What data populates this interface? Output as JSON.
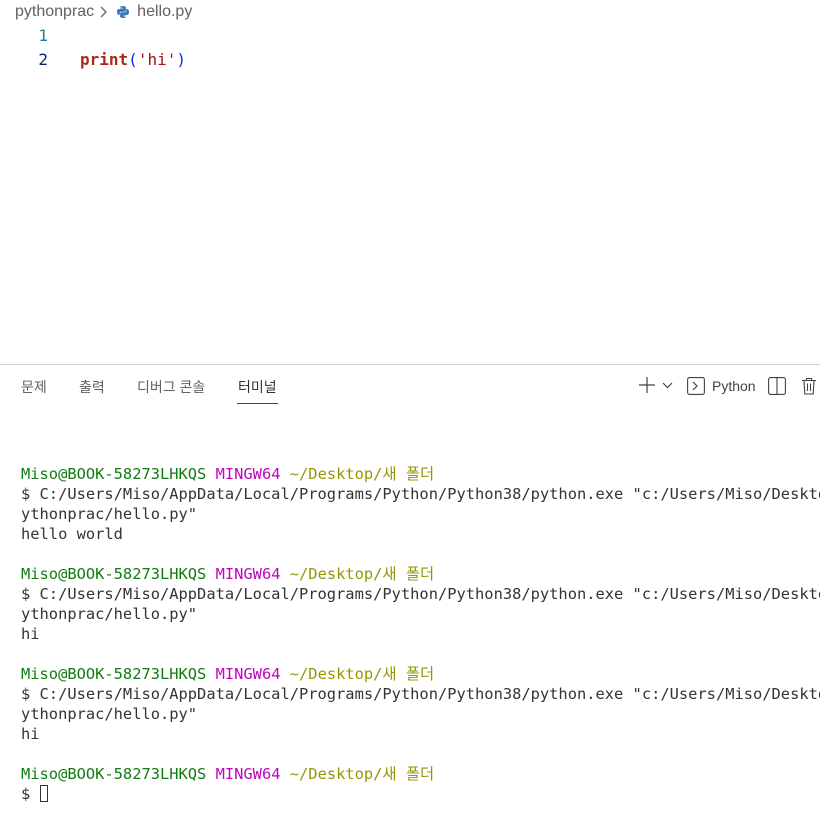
{
  "breadcrumb": {
    "folder": "pythonprac",
    "file": "hello.py"
  },
  "editor": {
    "lines": [
      {
        "number": "1",
        "tokens": []
      },
      {
        "number": "2",
        "fn": "print",
        "open": "(",
        "str": "'hi'",
        "close": ")"
      }
    ]
  },
  "panel": {
    "tabs": [
      "문제",
      "출력",
      "디버그 콘솔",
      "터미널"
    ],
    "active_tab": "터미널",
    "terminal_profile": "Python"
  },
  "terminal": {
    "blocks": [
      {
        "user": "Miso@BOOK-58273LHKQS",
        "env": "MINGW64",
        "path": "~/Desktop/새 폴더",
        "cmd1": "$ C:/Users/Miso/AppData/Local/Programs/Python/Python38/python.exe \"c:/Users/Miso/Desktop/",
        "cmd2": "ythonprac/hello.py\"",
        "output": "hello world"
      },
      {
        "user": "Miso@BOOK-58273LHKQS",
        "env": "MINGW64",
        "path": "~/Desktop/새 폴더",
        "cmd1": "$ C:/Users/Miso/AppData/Local/Programs/Python/Python38/python.exe \"c:/Users/Miso/Desktop/",
        "cmd2": "ythonprac/hello.py\"",
        "output": "hi"
      },
      {
        "user": "Miso@BOOK-58273LHKQS",
        "env": "MINGW64",
        "path": "~/Desktop/새 폴더",
        "cmd1": "$ C:/Users/Miso/AppData/Local/Programs/Python/Python38/python.exe \"c:/Users/Miso/Desktop/",
        "cmd2": "ythonprac/hello.py\"",
        "output": "hi"
      }
    ],
    "final_prompt": {
      "user": "Miso@BOOK-58273LHKQS",
      "env": "MINGW64",
      "path": "~/Desktop/새 폴더",
      "prompt": "$ "
    }
  },
  "colors": {
    "active_line_bg": "#e4f3df",
    "line_number": "#237893",
    "terminal_user": "#107c10",
    "terminal_env": "#bc05bc",
    "terminal_path": "#949800"
  },
  "icons": [
    "chevron-right-icon",
    "python-file-icon",
    "plus-icon",
    "chevron-down-icon",
    "terminal-icon",
    "split-terminal-icon",
    "trash-icon"
  ]
}
